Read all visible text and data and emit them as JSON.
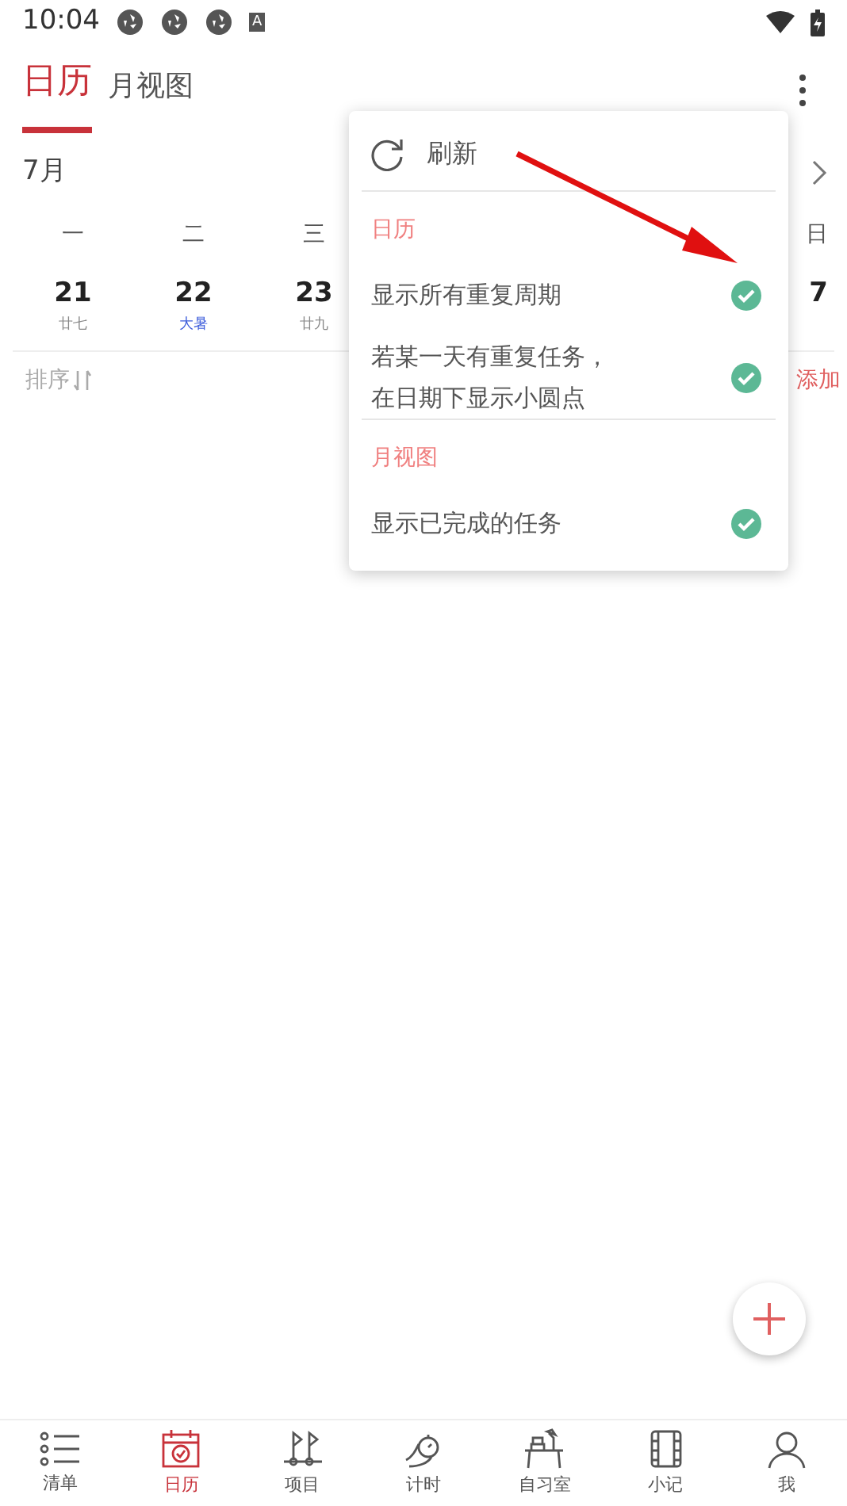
{
  "status_bar": {
    "time": "10:04",
    "badge": "A"
  },
  "tabs": [
    {
      "label": "日历",
      "selected": true
    },
    {
      "label": "月视图",
      "selected": false
    }
  ],
  "month": "7月",
  "week_left": [
    {
      "weekday": "一",
      "day": "21",
      "lunar": "廿七",
      "solar_term": false
    },
    {
      "weekday": "二",
      "day": "22",
      "lunar": "大暑",
      "solar_term": true
    },
    {
      "weekday": "三",
      "day": "23",
      "lunar": "廿九",
      "solar_term": false
    }
  ],
  "week_right": {
    "weekday": "日",
    "day": "7"
  },
  "sort_label": "排序",
  "add_label": "添加",
  "menu": {
    "refresh": "刷新",
    "sections": [
      {
        "title": "日历",
        "items": [
          {
            "lines": [
              "显示所有重复周期"
            ],
            "checked": true
          },
          {
            "lines": [
              "若某一天有重复任务，",
              "在日期下显示小圆点"
            ],
            "checked": true
          }
        ]
      },
      {
        "title": "月视图",
        "items": [
          {
            "lines": [
              "显示已完成的任务"
            ],
            "checked": true
          }
        ]
      }
    ]
  },
  "bottom_nav": [
    {
      "kind": "list",
      "label": "清单",
      "selected": false
    },
    {
      "kind": "calendar",
      "label": "日历",
      "selected": true
    },
    {
      "kind": "flags",
      "label": "项目",
      "selected": false
    },
    {
      "kind": "timer",
      "label": "计时",
      "selected": false
    },
    {
      "kind": "desk",
      "label": "自习室",
      "selected": false
    },
    {
      "kind": "note",
      "label": "小记",
      "selected": false
    },
    {
      "kind": "person",
      "label": "我",
      "selected": false
    }
  ]
}
